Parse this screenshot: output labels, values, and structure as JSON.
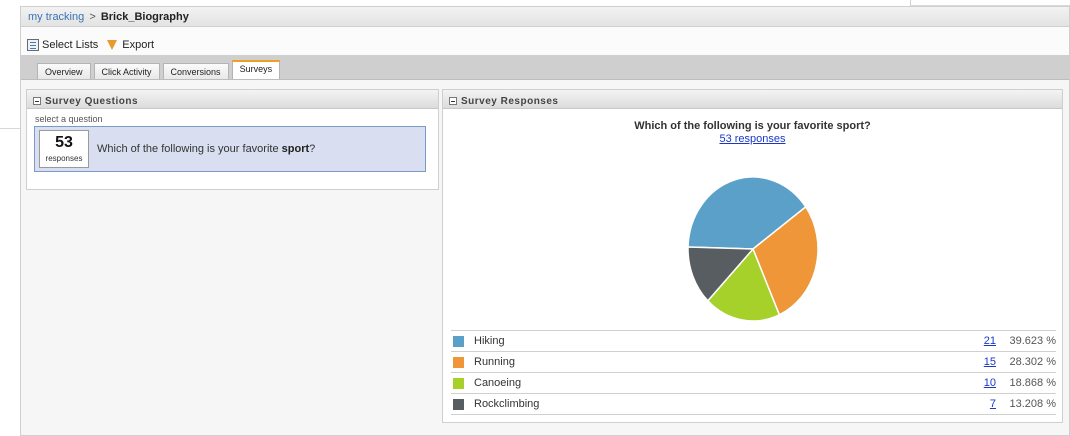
{
  "breadcrumb": {
    "root": "my tracking",
    "separator": ">",
    "current": "Brick_Biography"
  },
  "toolbar": {
    "select_lists": "Select Lists",
    "export": "Export"
  },
  "tabs": [
    {
      "label": "Overview",
      "active": false
    },
    {
      "label": "Click Activity",
      "active": false
    },
    {
      "label": "Conversions",
      "active": false
    },
    {
      "label": "Surveys",
      "active": true
    }
  ],
  "questions_panel": {
    "title": "Survey Questions",
    "select_label": "select a question",
    "question": {
      "count": "53",
      "count_label": "responses",
      "text_prefix": "Which of the following is your favorite",
      "text_bold": "sport",
      "text_suffix": "?"
    }
  },
  "responses_panel": {
    "title": "Survey Responses",
    "question_prefix": "Which of the following is your favorite",
    "question_bold": "sport",
    "question_suffix": "?",
    "responses_link": "53 responses"
  },
  "chart_data": {
    "type": "pie",
    "series": [
      {
        "name": "Hiking",
        "value": 21,
        "percent": "39.623 %",
        "color": "#5aa0c8"
      },
      {
        "name": "Running",
        "value": 15,
        "percent": "28.302 %",
        "color": "#ee9638"
      },
      {
        "name": "Canoeing",
        "value": 10,
        "percent": "18.868 %",
        "color": "#a6d02a"
      },
      {
        "name": "Rockclimbing",
        "value": 7,
        "percent": "13.208 %",
        "color": "#585d62"
      }
    ]
  }
}
